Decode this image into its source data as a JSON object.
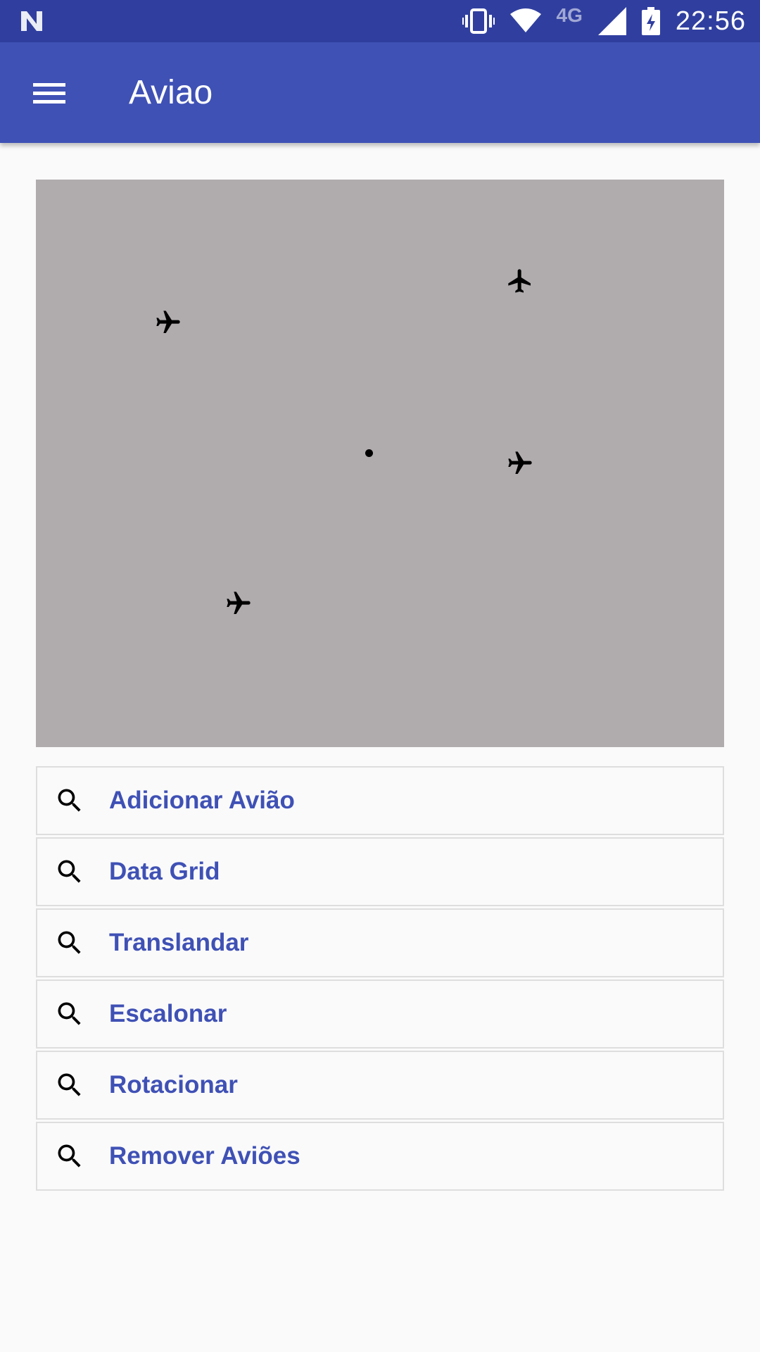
{
  "status_bar": {
    "left_icon": "n-notification-icon",
    "network_type": "4G",
    "time": "22:56",
    "icons": [
      "vibrate-icon",
      "wifi-icon",
      "signal-icon",
      "battery-charging-icon"
    ]
  },
  "app_bar": {
    "menu_icon": "hamburger-menu-icon",
    "title": "Aviao"
  },
  "canvas": {
    "background": "#b0abac",
    "planes": [
      {
        "name": "airplane-1",
        "heading": "north"
      },
      {
        "name": "airplane-2",
        "heading": "east"
      },
      {
        "name": "airplane-3",
        "heading": "east"
      },
      {
        "name": "airplane-4",
        "heading": "east"
      }
    ]
  },
  "menu": {
    "items": [
      {
        "label": "Adicionar Avião",
        "icon": "search-icon"
      },
      {
        "label": "Data Grid",
        "icon": "search-icon"
      },
      {
        "label": "Translandar",
        "icon": "search-icon"
      },
      {
        "label": "Escalonar",
        "icon": "search-icon"
      },
      {
        "label": "Rotacionar",
        "icon": "search-icon"
      },
      {
        "label": "Remover Aviões",
        "icon": "search-icon"
      }
    ]
  },
  "colors": {
    "status_bar": "#303f9f",
    "app_bar": "#3f51b5",
    "accent_text": "#3f51b5"
  }
}
